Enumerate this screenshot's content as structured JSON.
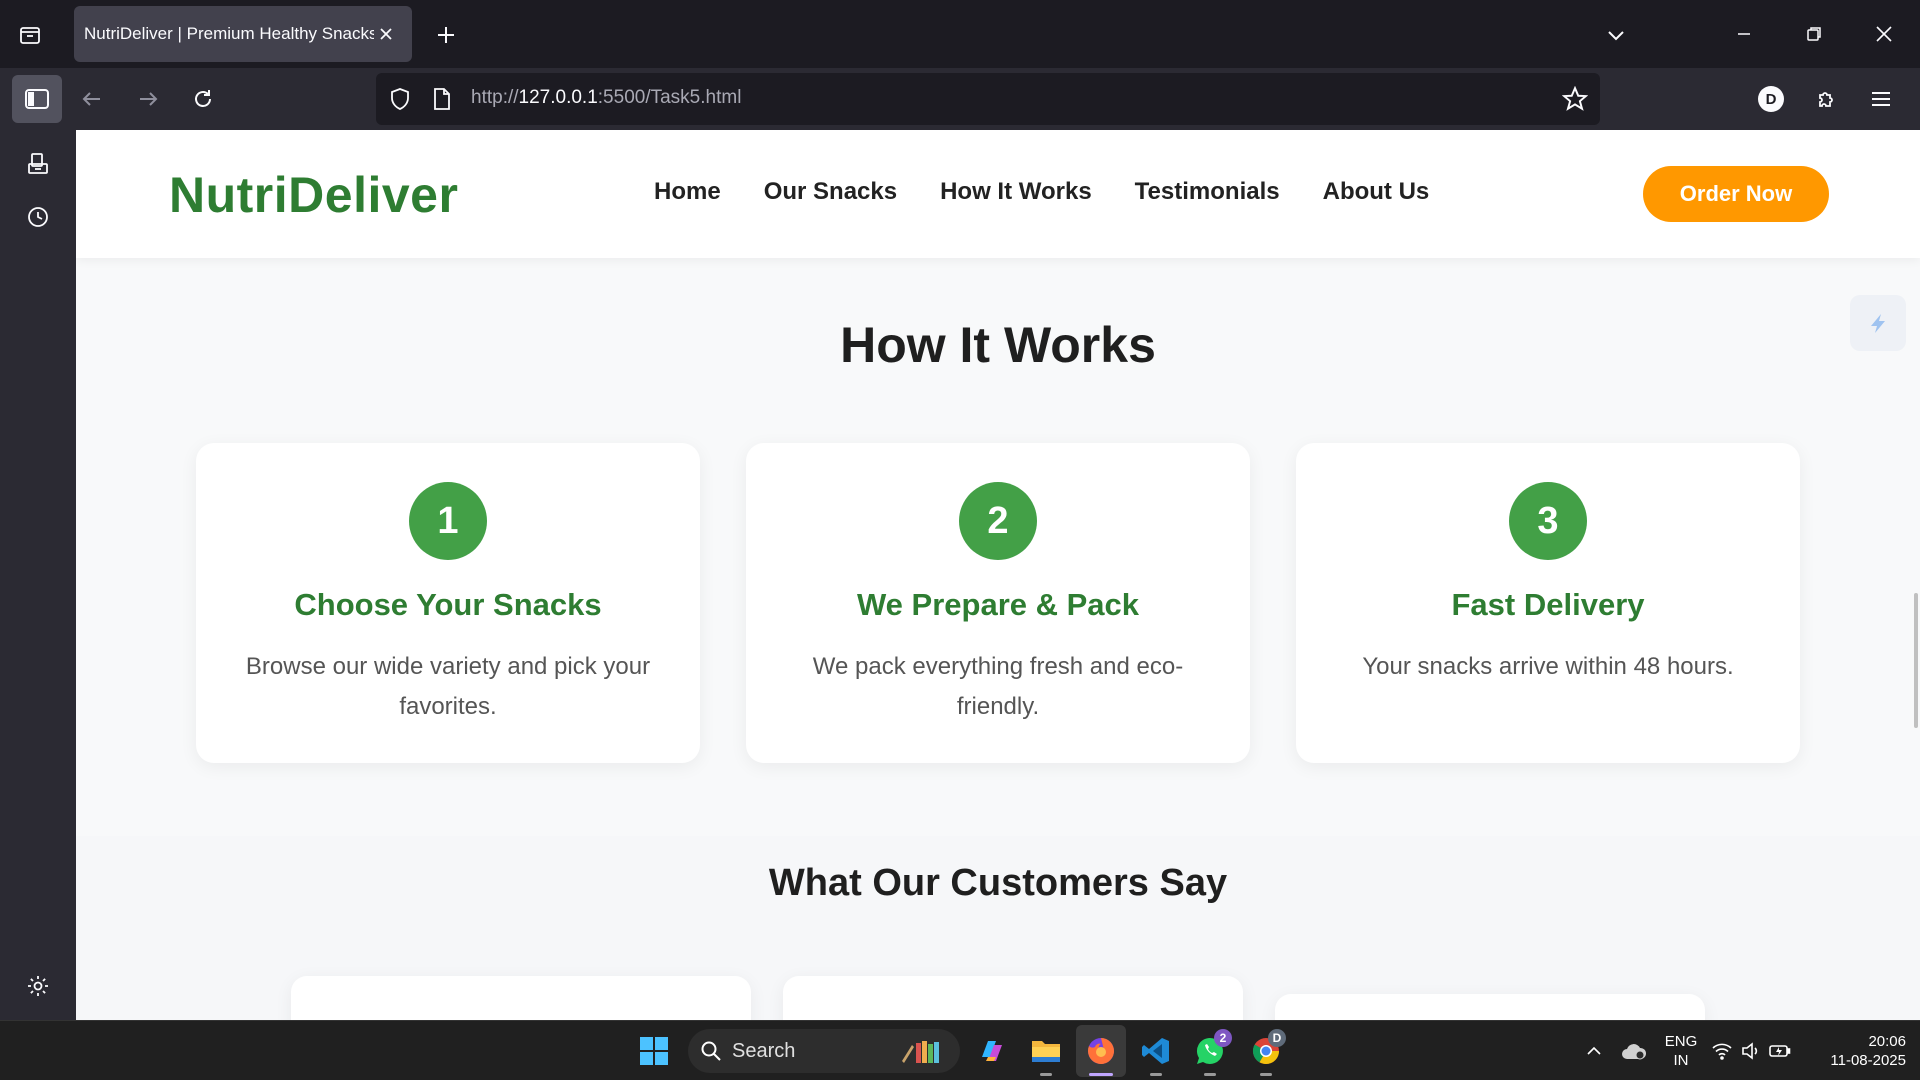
{
  "browser": {
    "tab_title": "NutriDeliver | Premium Healthy Snacks",
    "url_prefix": "http://",
    "url_host": "127.0.0.1",
    "url_rest": ":5500/Task5.html",
    "profile_initial": "D"
  },
  "site": {
    "logo": "NutriDeliver",
    "nav": [
      "Home",
      "Our Snacks",
      "How It Works",
      "Testimonials",
      "About Us"
    ],
    "order_button": "Order Now",
    "how_it_works_title": "How It Works",
    "steps": [
      {
        "number": "1",
        "title": "Choose Your Snacks",
        "description": "Browse our wide variety and pick your favorites."
      },
      {
        "number": "2",
        "title": "We Prepare & Pack",
        "description": "We pack everything fresh and eco-friendly."
      },
      {
        "number": "3",
        "title": "Fast Delivery",
        "description": "Your snacks arrive within 48 hours."
      }
    ],
    "testimonials_title": "What Our Customers Say"
  },
  "taskbar": {
    "search_label": "Search",
    "whatsapp_badge": "2",
    "chrome_badge": "D",
    "language": "ENG",
    "region": "IN",
    "time": "20:06",
    "date": "11-08-2025"
  },
  "colors": {
    "brand_green": "#2e7d32",
    "step_circle": "#43a047",
    "accent_orange": "#ff9800"
  }
}
